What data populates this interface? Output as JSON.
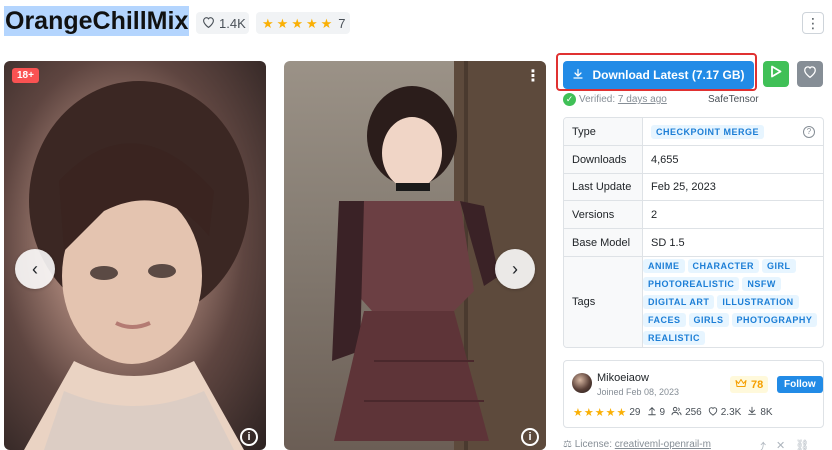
{
  "header": {
    "title": "OrangeChillMix",
    "likes": "1.4K",
    "rating_count": "7"
  },
  "gallery": {
    "nsfw_badge": "18+",
    "prev_glyph": "‹",
    "next_glyph": "›",
    "info_glyph": "i"
  },
  "actions": {
    "download_label": "Download Latest (7.17 GB)",
    "verified_label": "Verified:",
    "verified_time": "7 days ago",
    "safetensor": "SafeTensor"
  },
  "details": {
    "rows": [
      {
        "label": "Type",
        "value": "CHECKPOINT MERGE"
      },
      {
        "label": "Downloads",
        "value": "4,655"
      },
      {
        "label": "Last Update",
        "value": "Feb 25, 2023"
      },
      {
        "label": "Versions",
        "value": "2"
      },
      {
        "label": "Base Model",
        "value": "SD 1.5"
      },
      {
        "label": "Tags",
        "value": ""
      }
    ],
    "tags": [
      "ANIME",
      "CHARACTER",
      "GIRL",
      "PHOTOREALISTIC",
      "NSFW",
      "DIGITAL ART",
      "ILLUSTRATION",
      "FACES",
      "GIRLS",
      "PHOTOGRAPHY",
      "REALISTIC"
    ]
  },
  "creator": {
    "name": "Mikoeiaow",
    "joined": "Joined Feb 08, 2023",
    "rank": "78",
    "follow_label": "Follow",
    "rating_count": "29",
    "uploads": "9",
    "followers": "256",
    "likes": "2.3K",
    "downloads": "8K"
  },
  "license": {
    "label": "License:",
    "name": "creativeml-openrail-m"
  },
  "colors": {
    "accent_blue": "#228be6",
    "run_green": "#40c057",
    "highlight_red": "#e03131",
    "tag_bg": "#e7f5ff",
    "tag_text": "#1c7ed6"
  },
  "icons": [
    "heart-icon",
    "star-icon",
    "kebab-icon",
    "download-icon",
    "play-icon",
    "shield-check-icon",
    "help-icon",
    "crown-icon",
    "upload-icon",
    "users-icon",
    "license-icon",
    "share-icon",
    "twitter-icon"
  ]
}
